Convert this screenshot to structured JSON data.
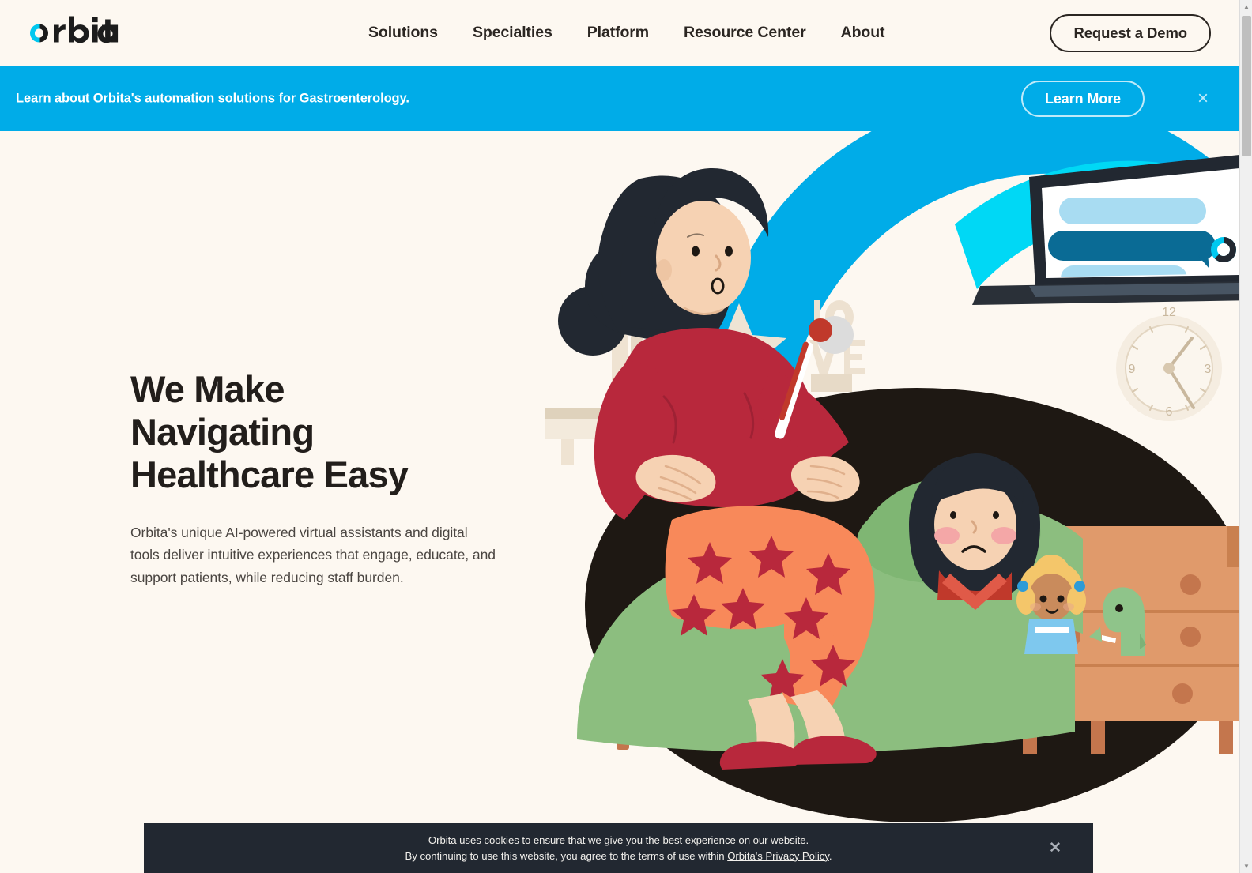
{
  "site": {
    "brand": "orbita",
    "background_color": "#FDF8F1",
    "accent_blue": "#00ACE8",
    "accent_cyan": "#00D8F5",
    "ink": "#221E1B"
  },
  "header": {
    "logo_label": "orbita",
    "nav": [
      {
        "label": "Solutions"
      },
      {
        "label": "Specialties"
      },
      {
        "label": "Platform"
      },
      {
        "label": "Resource Center"
      },
      {
        "label": "About"
      }
    ],
    "cta": {
      "label": "Request a Demo"
    }
  },
  "announcement": {
    "message": "Learn about Orbita's automation solutions for Gastroenterology.",
    "button_label": "Learn More",
    "close_label": "×",
    "background_color": "#00ACE8"
  },
  "hero": {
    "title": "We Make\nNavigating\nHealthcare Easy",
    "subtitle": "Orbita's unique AI-powered virtual assistants and digital tools deliver intuitive experiences that engage, educate, and support patients, while reducing staff burden.",
    "illustration": {
      "name": "caregiver-with-sick-child-illustration",
      "description": "Woman in red sweater and orange star pajamas sits on a bed holding a thermometer beside a sick child under a green blanket, with a laptop showing a chat assistant on a wooden dresser, bookshelf, star, LOVE letters and wall clock in the background.",
      "clock_time": "1:20",
      "shelf_letters": "LOVE",
      "colors": {
        "arc_outer": "#00ACE8",
        "arc_inner": "#00D8F5",
        "blanket_green": "#8CBE7F",
        "sweater_red": "#B8283C",
        "pants_orange": "#F8895A",
        "star_red": "#B8283C",
        "hair_dark": "#222831",
        "skin": "#F6D2B3",
        "wood": "#D98B5F",
        "ground_dark": "#1E1813",
        "shelf_cream": "#EFE4D4"
      }
    }
  },
  "cookie_bar": {
    "line1": "Orbita uses cookies to ensure that we give you the best experience on our website.",
    "line2_prefix": "By continuing to use this website, you agree to the terms of use within ",
    "link_label": "Orbita's Privacy Policy",
    "line2_suffix": ".",
    "close_label": "✕",
    "background_color": "#222831"
  },
  "scrollbar": {
    "up_arrow": "▲",
    "down_arrow": "▼"
  }
}
